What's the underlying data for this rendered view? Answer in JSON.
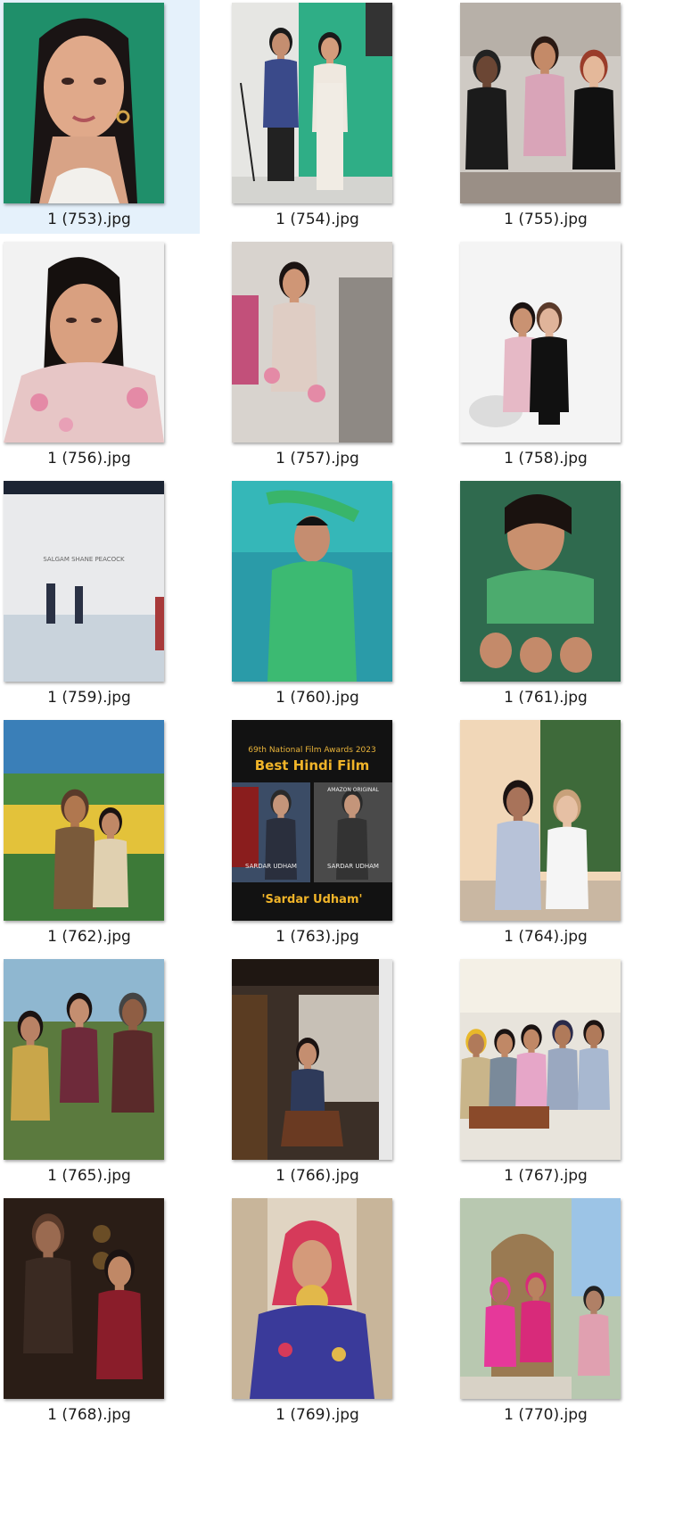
{
  "window": {
    "view": "Large icons",
    "selected_file": "1 (753).jpg"
  },
  "colors": {
    "selection_bg": "#e5f1fb",
    "label_text": "#1b1b1b"
  },
  "files": [
    {
      "name": "1 (753).jpg",
      "thumb": "portrait-green-backdrop"
    },
    {
      "name": "1 (754).jpg",
      "thumb": "makeup-studio-greenscreen"
    },
    {
      "name": "1 (755).jpg",
      "thumb": "fashion-show-front-row"
    },
    {
      "name": "1 (756).jpg",
      "thumb": "portrait-floral-jacket"
    },
    {
      "name": "1 (757).jpg",
      "thumb": "floral-jacket-hallway"
    },
    {
      "name": "1 (758).jpg",
      "thumb": "two-women-white-studio"
    },
    {
      "name": "1 (759).jpg",
      "thumb": "runway-white-wall"
    },
    {
      "name": "1 (760).jpg",
      "thumb": "green-outfit-teal-backdrop"
    },
    {
      "name": "1 (761).jpg",
      "thumb": "kaleidoscope-green-portrait"
    },
    {
      "name": "1 (762).jpg",
      "thumb": "couple-painted-field"
    },
    {
      "name": "1 (763).jpg",
      "thumb": "film-award-poster"
    },
    {
      "name": "1 (764).jpg",
      "thumb": "two-people-outdoors"
    },
    {
      "name": "1 (765).jpg",
      "thumb": "group-outdoor-picnic"
    },
    {
      "name": "1 (766).jpg",
      "thumb": "mirror-selfie-set"
    },
    {
      "name": "1 (767).jpg",
      "thumb": "classroom-group"
    },
    {
      "name": "1 (768).jpg",
      "thumb": "couple-warm-lights"
    },
    {
      "name": "1 (769).jpg",
      "thumb": "traditional-dress-portrait"
    },
    {
      "name": "1 (770).jpg",
      "thumb": "palace-doorway-women"
    }
  ],
  "poster": {
    "line1": "69th National Film Awards 2023",
    "line2": "Best Hindi Film",
    "brand": "AMAZON ORIGINAL",
    "caption_left": "SARDAR UDHAM",
    "caption_right": "SARDAR UDHAM",
    "footer": "'Sardar Udham'"
  },
  "runway_sign": "SALGAM SHANE PEACOCK"
}
